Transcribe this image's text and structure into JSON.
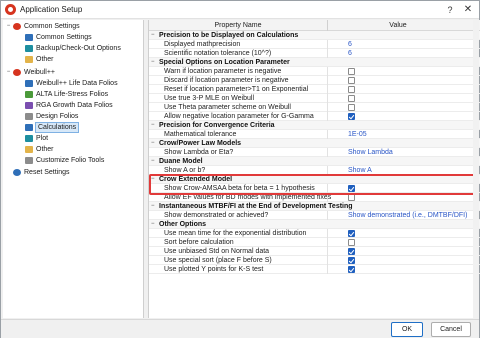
{
  "window": {
    "title": "Application Setup",
    "help_glyph": "?",
    "close_glyph": "✕"
  },
  "sidebar": {
    "items": [
      {
        "label": "Common Settings",
        "icon": "app-logo-icon"
      },
      {
        "label": "Common Settings",
        "icon": "settings-icon"
      },
      {
        "label": "Backup/Check-Out Options",
        "icon": "backup-icon"
      },
      {
        "label": "Other",
        "icon": "folder-icon"
      },
      {
        "label": "Weibull++",
        "icon": "weibull-logo-icon"
      },
      {
        "label": "Weibull++ Life Data Folios",
        "icon": "folio-icon"
      },
      {
        "label": "ALTA Life-Stress Folios",
        "icon": "alta-icon"
      },
      {
        "label": "RGA Growth Data Folios",
        "icon": "rga-icon"
      },
      {
        "label": "Design Folios",
        "icon": "design-icon"
      },
      {
        "label": "Calculations",
        "icon": "calculator-icon"
      },
      {
        "label": "Plot",
        "icon": "plot-icon"
      },
      {
        "label": "Other",
        "icon": "folder-icon"
      },
      {
        "label": "Customize Folio Tools",
        "icon": "tools-icon"
      },
      {
        "label": "Reset Settings",
        "icon": "reset-icon"
      }
    ]
  },
  "grid": {
    "header": {
      "property": "Property Name",
      "value": "Value"
    },
    "rows": [
      {
        "kind": "cat",
        "name": "Precision to be Displayed on Calculations"
      },
      {
        "kind": "prop",
        "name": "Displayed mathprecision",
        "value": "6",
        "dropdown": true
      },
      {
        "kind": "prop",
        "name": "Scientific notation tolerance (10^?)",
        "value": "6",
        "dropdown": true
      },
      {
        "kind": "cat",
        "name": "Special Options on Location Parameter"
      },
      {
        "kind": "prop",
        "name": "Warn if location parameter is negative",
        "checked": false
      },
      {
        "kind": "prop",
        "name": "Discard if location parameter is negative",
        "checked": false
      },
      {
        "kind": "prop",
        "name": "Reset if location parameter>T1 on Exponential",
        "checked": false
      },
      {
        "kind": "prop",
        "name": "Use true 3-P MLE on Weibull",
        "checked": false
      },
      {
        "kind": "prop",
        "name": "Use Theta parameter scheme on Weibull",
        "checked": false
      },
      {
        "kind": "prop",
        "name": "Allow negative location parameter for G-Gamma",
        "checked": true
      },
      {
        "kind": "cat",
        "name": "Precision for Convergence Criteria"
      },
      {
        "kind": "prop",
        "name": "Mathematical tolerance",
        "value": "1E-05",
        "dropdown": false
      },
      {
        "kind": "cat",
        "name": "Crow/Power Law Models"
      },
      {
        "kind": "prop",
        "name": "Show Lambda or Eta?",
        "value": "Show Lambda",
        "dropdown": true
      },
      {
        "kind": "cat",
        "name": "Duane Model"
      },
      {
        "kind": "prop",
        "name": "Show A or b?",
        "value": "Show A",
        "dropdown": true
      },
      {
        "kind": "cat",
        "name": "Crow Extended Model"
      },
      {
        "kind": "prop",
        "name": "Show Crow-AMSAA beta for beta = 1 hypothesis",
        "checked": true
      },
      {
        "kind": "prop",
        "name": "Allow EF values for BD modes with implemented fixes",
        "checked": false
      },
      {
        "kind": "cat",
        "name": "Instantaneous MTBF/FI at the End of Development Testing"
      },
      {
        "kind": "prop",
        "name": "Show demonstrated or achieved?",
        "value": "Show demonstrated (i.e., DMTBF/DFI)",
        "dropdown": true
      },
      {
        "kind": "cat",
        "name": "Other Options"
      },
      {
        "kind": "prop",
        "name": "Use mean time for the exponential distribution",
        "checked": true
      },
      {
        "kind": "prop",
        "name": "Sort before calculation",
        "checked": false
      },
      {
        "kind": "prop",
        "name": "Use unbiased Std on Normal data",
        "checked": true
      },
      {
        "kind": "prop",
        "name": "Use special sort (place F before S)",
        "checked": true
      },
      {
        "kind": "prop",
        "name": "Use plotted Y points for K-S test",
        "checked": true
      }
    ]
  },
  "buttons": {
    "ok": "OK",
    "cancel": "Cancel"
  },
  "colors": {
    "accent": "#1f5fbf",
    "highlight_border": "#e13a3a",
    "value_text": "#2a56c6"
  }
}
